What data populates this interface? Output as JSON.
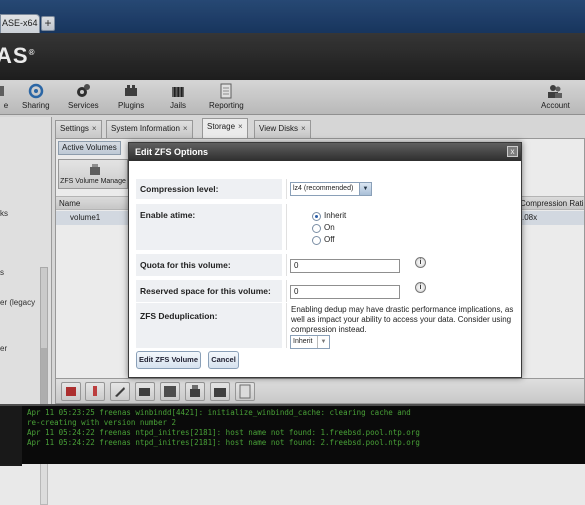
{
  "browser": {
    "tab_title": "ASE-x64 (...",
    "new_tab": "+"
  },
  "brand": {
    "text": "AS",
    "mark": "®"
  },
  "nav": {
    "items": [
      {
        "label": "e",
        "icon": "partial-icon"
      },
      {
        "label": "Sharing",
        "icon": "sharing-icon"
      },
      {
        "label": "Services",
        "icon": "services-gear-icon"
      },
      {
        "label": "Plugins",
        "icon": "plugins-icon"
      },
      {
        "label": "Jails",
        "icon": "jails-icon"
      },
      {
        "label": "Reporting",
        "icon": "reporting-icon"
      },
      {
        "label": "Account",
        "icon": "account-icon"
      }
    ]
  },
  "left_tree": {
    "items": [
      "ks",
      "s",
      "er (legacy",
      "er"
    ]
  },
  "main_tabs": [
    {
      "label": "Settings",
      "close": "×"
    },
    {
      "label": "System Information",
      "close": "×"
    },
    {
      "label": "Storage",
      "close": "×"
    },
    {
      "label": "View Disks",
      "close": "×"
    }
  ],
  "storage": {
    "subtab": "Active Volumes",
    "volume_manager_button": "ZFS Volume Manage",
    "columns": {
      "name": "Name",
      "compression": "Compression Rati"
    },
    "rows": [
      {
        "name": "volume1",
        "compression": ".08x"
      }
    ]
  },
  "console": {
    "lines": [
      "Apr 11 05:23:25 freenas winbindd[4421]:   initialize_winbindd_cache: clearing cache and",
      "re-creating with version number 2",
      "Apr 11 05:24:22 freenas ntpd_initres[2181]: host name not found: 1.freebsd.pool.ntp.org",
      "Apr 11 05:24:22 freenas ntpd_initres[2181]: host name not found: 2.freebsd.pool.ntp.org"
    ]
  },
  "modal": {
    "title": "Edit ZFS Options",
    "close": "x",
    "compression": {
      "label": "Compression level:",
      "value": "lz4 (recommended)"
    },
    "atime": {
      "label": "Enable atime:",
      "options": [
        "Inherit",
        "On",
        "Off"
      ],
      "selected": "Inherit"
    },
    "quota": {
      "label": "Quota for this volume:",
      "value": "0"
    },
    "reserved": {
      "label": "Reserved space for this volume:",
      "value": "0"
    },
    "dedup": {
      "label": "ZFS Deduplication:",
      "help": "Enabling dedup may have drastic performance implications, as well as impact your ability to access your data. Consider using compression instead.",
      "value": "Inherit"
    },
    "help_glyph": "i",
    "submit_label": "Edit ZFS Volume",
    "cancel_label": "Cancel"
  }
}
